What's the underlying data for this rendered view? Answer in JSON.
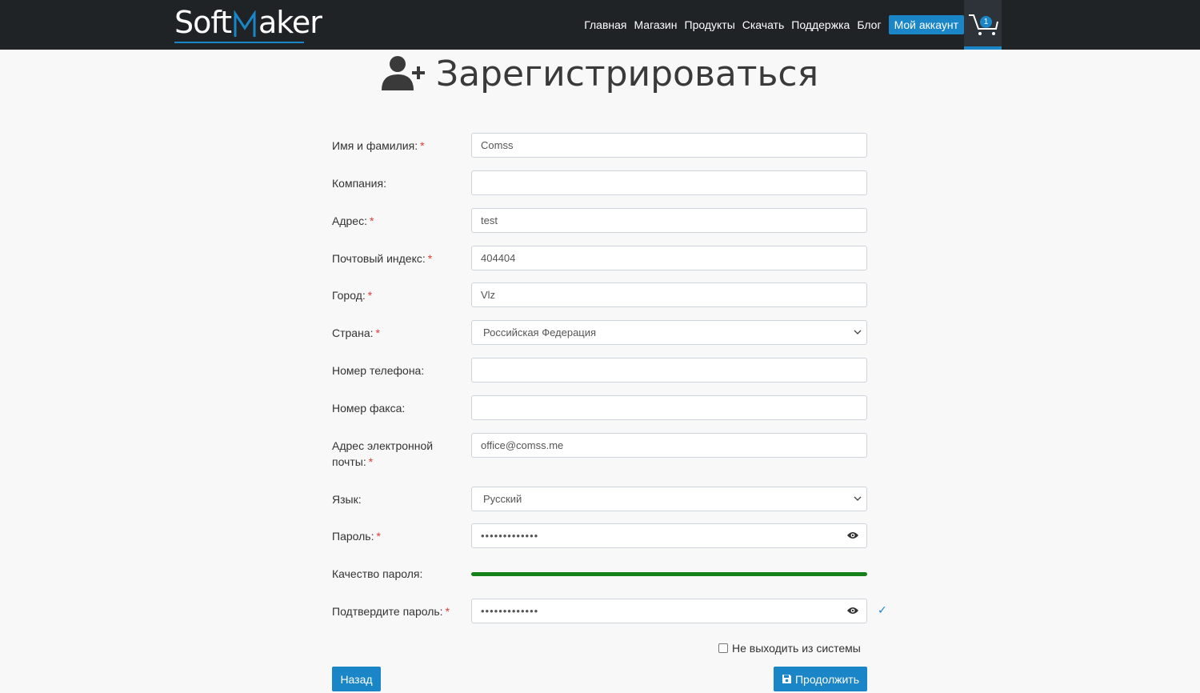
{
  "header": {
    "logo_left": "Soft",
    "logo_right": "aker",
    "nav": [
      "Главная",
      "Магазин",
      "Продукты",
      "Скачать",
      "Поддержка",
      "Блог"
    ],
    "account": "Мой аккаунт",
    "cart_count": "1"
  },
  "page": {
    "title": "Зарегистрироваться"
  },
  "form": {
    "name_label": "Имя и фамилия:",
    "name_value": "Comss",
    "company_label": "Компания:",
    "company_value": "",
    "address_label": "Адрес:",
    "address_value": "test",
    "zip_label": "Почтовый индекс:",
    "zip_value": "404404",
    "city_label": "Город:",
    "city_value": "Vlz",
    "country_label": "Страна:",
    "country_value": "Российская Федерация",
    "phone_label": "Номер телефона:",
    "phone_value": "",
    "fax_label": "Номер факса:",
    "fax_value": "",
    "email_label_line1": "Адрес электронной",
    "email_label_line2": "почты:",
    "email_value": "office@comss.me",
    "language_label": "Язык:",
    "language_value": "Русский",
    "password_label": "Пароль:",
    "password_value": "•••••••••••••",
    "quality_label": "Качество пароля:",
    "quality_fraction": 1.0,
    "confirm_label": "Подтвердите пароль:",
    "confirm_value": "•••••••••••••",
    "confirm_check": "✓",
    "required_mark": "*",
    "remember_label": "Не выходить из системы",
    "back_button": "Назад",
    "continue_button": "Продолжить"
  },
  "colors": {
    "accent": "#1a86c8",
    "header_bg": "#1f2326",
    "strength": "#16801a"
  }
}
